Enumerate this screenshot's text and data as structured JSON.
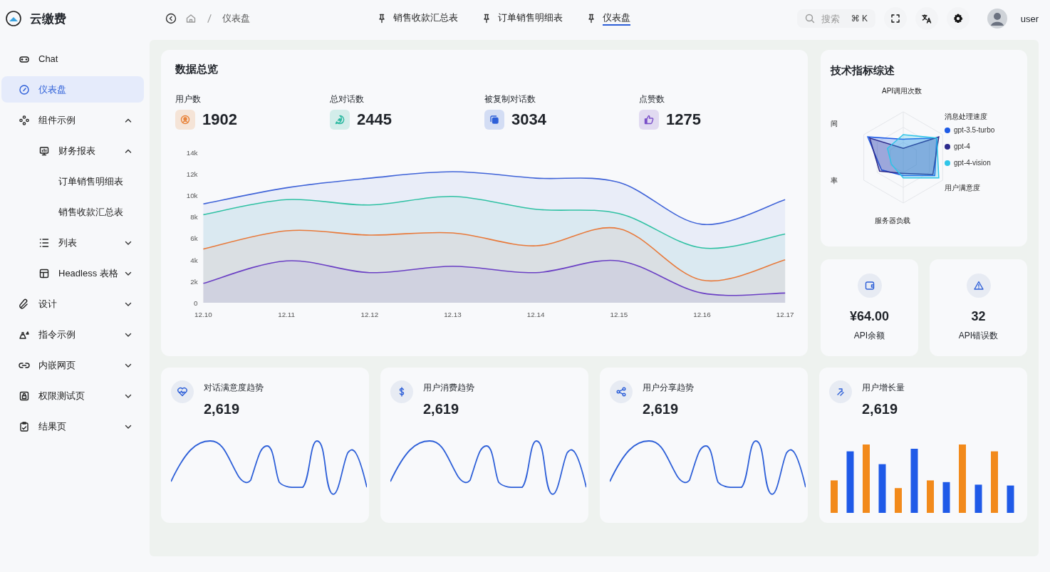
{
  "app": {
    "name": "云缴费"
  },
  "breadcrumb": [
    "仪表盘"
  ],
  "tabs": [
    {
      "label": "销售收款汇总表",
      "selected": false
    },
    {
      "label": "订单销售明细表",
      "selected": false
    },
    {
      "label": "仪表盘",
      "selected": true
    }
  ],
  "search": {
    "placeholder": "搜索",
    "shortcut": "⌘ K"
  },
  "user": {
    "name": "user"
  },
  "sidebar": {
    "items": [
      {
        "label": "Chat",
        "selected": false
      },
      {
        "label": "仪表盘",
        "selected": true
      },
      {
        "label": "组件示例",
        "selected": false,
        "expanded": true,
        "children": [
          {
            "label": "财务报表",
            "selected": false,
            "expanded": true,
            "children": [
              {
                "label": "订单销售明细表",
                "selected": false
              },
              {
                "label": "销售收款汇总表",
                "selected": false
              }
            ]
          },
          {
            "label": "列表",
            "selected": false,
            "expanded": false
          },
          {
            "label": "Headless 表格",
            "selected": false,
            "expanded": false
          }
        ]
      },
      {
        "label": "设计",
        "selected": false,
        "expanded": false
      },
      {
        "label": "指令示例",
        "selected": false,
        "expanded": false
      },
      {
        "label": "内嵌网页",
        "selected": false,
        "expanded": false
      },
      {
        "label": "权限测试页",
        "selected": false,
        "expanded": false
      },
      {
        "label": "结果页",
        "selected": false,
        "expanded": false
      }
    ]
  },
  "overview": {
    "title": "数据总览",
    "stats": [
      {
        "label": "用户数",
        "value": "1902",
        "color": "#e8833a"
      },
      {
        "label": "总对话数",
        "value": "2445",
        "color": "#2bb8a0"
      },
      {
        "label": "被复制对话数",
        "value": "3034",
        "color": "#2d5fd8"
      },
      {
        "label": "点赞数",
        "value": "1275",
        "color": "#7a4fc9"
      }
    ],
    "chart_data": {
      "type": "area",
      "categories": [
        "12.10",
        "12.11",
        "12.12",
        "12.13",
        "12.14",
        "12.15",
        "12.16",
        "12.17"
      ],
      "ylim": [
        0,
        14000
      ],
      "yticks": [
        {
          "value": 0,
          "label": "0"
        },
        {
          "value": 2000,
          "label": "2k"
        },
        {
          "value": 4000,
          "label": "4k"
        },
        {
          "value": 6000,
          "label": "6k"
        },
        {
          "value": 8000,
          "label": "8k"
        },
        {
          "value": 10000,
          "label": "10k"
        },
        {
          "value": 12000,
          "label": "12k"
        },
        {
          "value": 14000,
          "label": "14k"
        }
      ],
      "series": [
        {
          "color": "#3f63d8",
          "values": [
            9200,
            10700,
            11600,
            12200,
            11600,
            11200,
            7300,
            9600
          ]
        },
        {
          "color": "#2fc1a3",
          "values": [
            8200,
            9600,
            9100,
            9900,
            8700,
            8300,
            5100,
            6400
          ]
        },
        {
          "color": "#e8793a",
          "values": [
            5000,
            6700,
            6300,
            6500,
            5300,
            6900,
            2100,
            4000
          ]
        },
        {
          "color": "#6a3fc4",
          "values": [
            1800,
            3900,
            2800,
            3400,
            2800,
            3900,
            900,
            900
          ]
        }
      ]
    }
  },
  "tech": {
    "title": "技术指标综述",
    "axes": [
      "API调用次数",
      "消息处理速度",
      "用户满意度",
      "服务器负载",
      "率",
      "间"
    ],
    "legend": [
      {
        "name": "gpt-3.5-turbo",
        "color": "#1e5be6"
      },
      {
        "name": "gpt-4",
        "color": "#2c2a8c"
      },
      {
        "name": "gpt-4-vision",
        "color": "#2ec5e8"
      }
    ]
  },
  "kpis": [
    {
      "value": "¥64.00",
      "label": "API余额"
    },
    {
      "value": "32",
      "label": "API错误数"
    }
  ],
  "trends": [
    {
      "kind": "line",
      "title": "对话满意度趋势",
      "value": "2,619"
    },
    {
      "kind": "line",
      "title": "用户消费趋势",
      "value": "2,619"
    },
    {
      "kind": "line",
      "title": "用户分享趋势",
      "value": "2,619"
    },
    {
      "kind": "bar",
      "title": "用户增长量",
      "value": "2,619"
    }
  ]
}
